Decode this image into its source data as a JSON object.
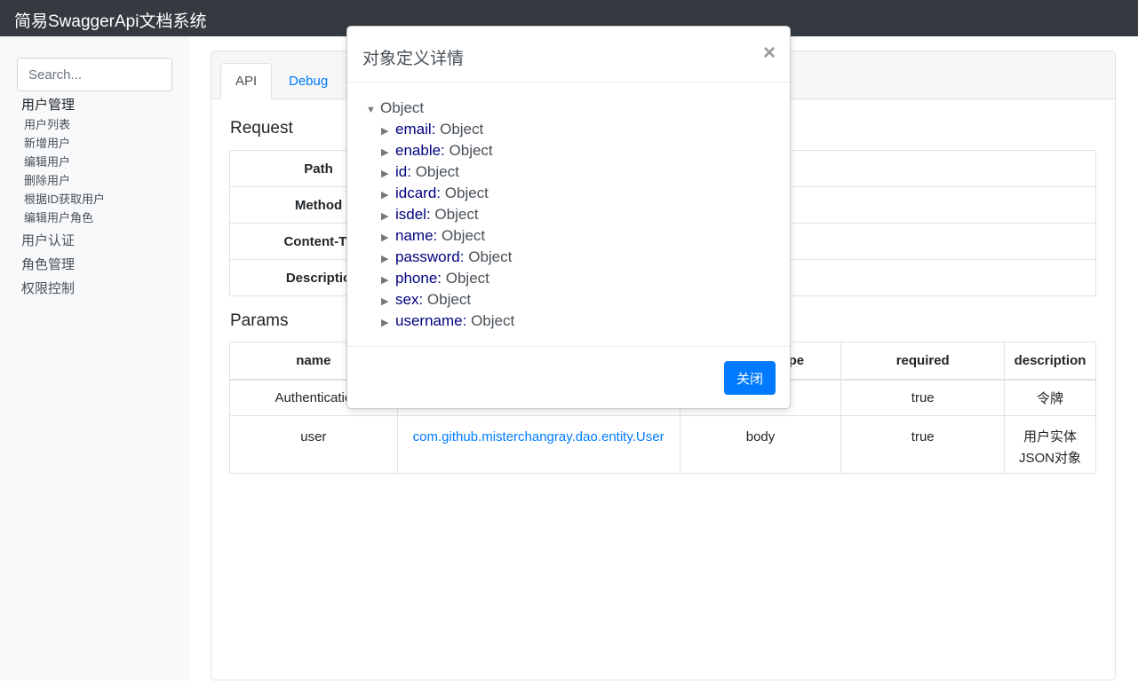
{
  "navbar": {
    "title": "简易SwaggerApi文档系统"
  },
  "sidebar": {
    "search_placeholder": "Search...",
    "groups": [
      {
        "title": "用户管理",
        "items": [
          "用户列表",
          "新增用户",
          "编辑用户",
          "删除用户",
          "根据ID获取用户",
          "编辑用户角色"
        ]
      },
      {
        "title": "用户认证"
      },
      {
        "title": "角色管理"
      },
      {
        "title": "权限控制"
      }
    ]
  },
  "tabs": [
    "API",
    "Debug"
  ],
  "request": {
    "title": "Request",
    "rows": [
      {
        "label": "Path"
      },
      {
        "label": "Method"
      },
      {
        "label": "Content-Ty"
      },
      {
        "label": "Descriptio"
      }
    ]
  },
  "params": {
    "title": "Params",
    "headers": {
      "name": "name",
      "type": "pe",
      "required": "required",
      "description": "description"
    },
    "rows": [
      {
        "name": "Authenticatio",
        "schema": "",
        "in": "",
        "required": "true",
        "description": "令牌"
      },
      {
        "name": "user",
        "schema": "com.github.misterchangray.dao.entity.User",
        "in": "body",
        "required": "true",
        "description": "用户实体JSON对象"
      }
    ]
  },
  "modal": {
    "title": "对象定义详情",
    "close_symbol": "×",
    "root": "Object",
    "fields": [
      {
        "key": "email:",
        "value": "Object"
      },
      {
        "key": "enable:",
        "value": "Object"
      },
      {
        "key": "id:",
        "value": "Object"
      },
      {
        "key": "idcard:",
        "value": "Object"
      },
      {
        "key": "isdel:",
        "value": "Object"
      },
      {
        "key": "name:",
        "value": "Object"
      },
      {
        "key": "password:",
        "value": "Object"
      },
      {
        "key": "phone:",
        "value": "Object"
      },
      {
        "key": "sex:",
        "value": "Object"
      },
      {
        "key": "username:",
        "value": "Object"
      }
    ],
    "close_button": "关闭"
  },
  "colors": {
    "primary": "#007bff",
    "navbar": "#343a40",
    "sidebar": "#f8f9fa",
    "tree_key": "#000080"
  }
}
